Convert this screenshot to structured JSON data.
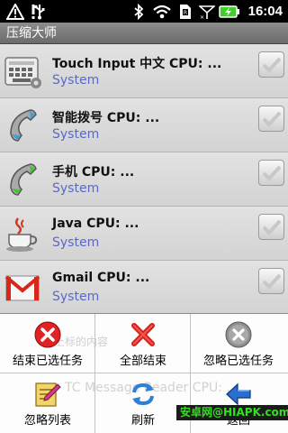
{
  "status_bar": {
    "time": "16:04"
  },
  "title_bar": {
    "title": "压缩大师"
  },
  "process_list": [
    {
      "name": "Touch Input 中文  CPU: ...",
      "type": "System",
      "icon": "keyboard-icon"
    },
    {
      "name": "智能拨号  CPU: ...",
      "type": "System",
      "icon": "phone-icon"
    },
    {
      "name": "手机  CPU: ...",
      "type": "System",
      "icon": "phone-icon"
    },
    {
      "name": "Java  CPU: ...",
      "type": "System",
      "icon": "coffee-cup-icon"
    },
    {
      "name": "Gmail  CPU: ...",
      "type": "System",
      "icon": "gmail-icon"
    }
  ],
  "menu": {
    "items": [
      {
        "label": "结束已选任务",
        "icon": "red-x-circle-icon"
      },
      {
        "label": "全部结束",
        "icon": "red-x-icon"
      },
      {
        "label": "忽略已选任务",
        "icon": "gray-x-circle-icon"
      },
      {
        "label": "忽略列表",
        "icon": "edit-list-icon"
      },
      {
        "label": "刷新",
        "icon": "refresh-icon"
      },
      {
        "label": "返回",
        "icon": "back-arrow-icon"
      }
    ],
    "faded_text_1": "上标的内容",
    "faded_text_2": "TC Message Reader  CPU: ..."
  },
  "watermark": "安卓网@HIAPK.com",
  "colors": {
    "accent_blue": "#5a68c8",
    "title_bar": "#7b7b7b",
    "watermark_green": "#33e01f"
  }
}
